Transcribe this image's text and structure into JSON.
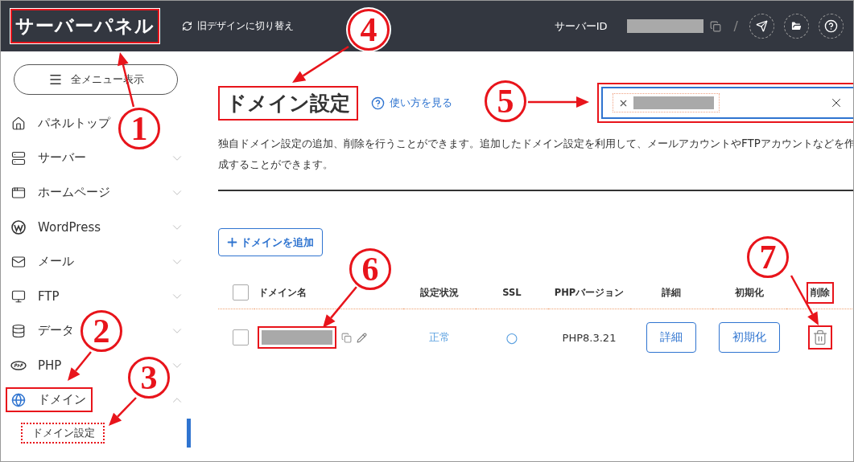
{
  "header": {
    "logo": {
      "text": "サーバーパネル",
      "highlighted": true
    },
    "switch_design": "旧デザインに切り替え",
    "server_id_label": "サーバーID",
    "separator": "/"
  },
  "sidebar": {
    "menu_button": "全メニュー表示",
    "items": [
      {
        "label": "パネルトップ",
        "kind": "link",
        "highlighted": false
      },
      {
        "label": "サーバー",
        "kind": "group",
        "expanded": false,
        "highlighted": false
      },
      {
        "label": "ホームページ",
        "kind": "group",
        "expanded": false,
        "highlighted": false
      },
      {
        "label": "WordPress",
        "kind": "group",
        "expanded": false,
        "highlighted": false
      },
      {
        "label": "メール",
        "kind": "group",
        "expanded": false,
        "highlighted": false
      },
      {
        "label": "FTP",
        "kind": "group",
        "expanded": false,
        "highlighted": false
      },
      {
        "label": "データ",
        "kind": "group",
        "expanded": false,
        "highlighted": false
      },
      {
        "label": "PHP",
        "kind": "group",
        "expanded": false,
        "highlighted": false
      },
      {
        "label": "ドメイン",
        "kind": "group",
        "expanded": true,
        "highlighted": true,
        "children": [
          {
            "label": "ドメイン設定",
            "selected": true,
            "highlighted": true
          }
        ]
      }
    ]
  },
  "main": {
    "title": {
      "text": "ドメイン設定",
      "highlighted": true
    },
    "help_link": "使い方を見る",
    "search": {
      "highlighted": true
    },
    "description": "独自ドメイン設定の追加、削除を行うことができます。追加したドメイン設定を利用して、メールアカウントやFTPアカウントなどを作成することができます。",
    "add_button": "ドメインを追加",
    "table": {
      "select_all": {
        "checked": false
      },
      "columns": [
        {
          "label": "ドメイン名",
          "highlighted": false
        },
        {
          "label": "設定状況",
          "highlighted": false
        },
        {
          "label": "SSL",
          "highlighted": false
        },
        {
          "label": "PHPバージョン",
          "highlighted": false
        },
        {
          "label": "詳細",
          "highlighted": false
        },
        {
          "label": "初期化",
          "highlighted": false
        },
        {
          "label": "削除",
          "highlighted": true
        }
      ],
      "rows": [
        {
          "checked": false,
          "name_highlighted": true,
          "status": "正常",
          "ssl": "○",
          "php": "PHP8.3.21",
          "detail_button": "詳細",
          "reset_button": "初期化",
          "delete_highlighted": true
        }
      ]
    }
  },
  "markers": [
    {
      "label": "1"
    },
    {
      "label": "2"
    },
    {
      "label": "3"
    },
    {
      "label": "4"
    },
    {
      "label": "5"
    },
    {
      "label": "6"
    },
    {
      "label": "7"
    }
  ]
}
